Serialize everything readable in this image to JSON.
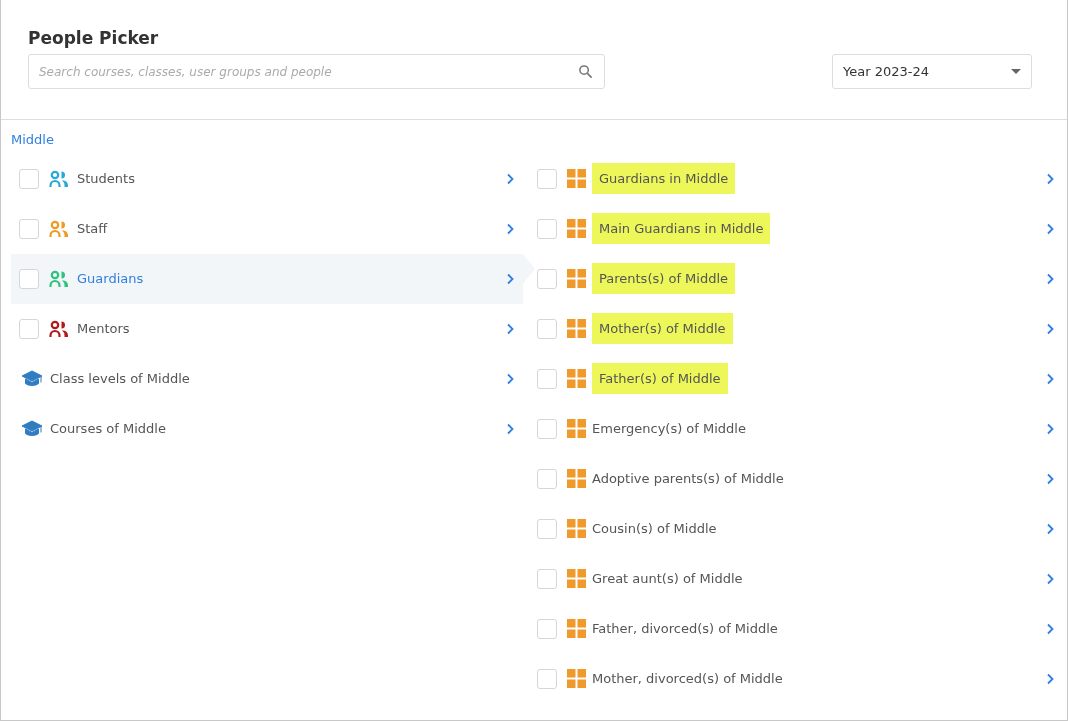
{
  "title": "People Picker",
  "search": {
    "placeholder": "Search courses, classes, user groups and people"
  },
  "year_select": {
    "value": "Year 2023-24"
  },
  "breadcrumb": "Middle",
  "categories": [
    {
      "kind": "group",
      "label": "Students",
      "color": "#29a8d8",
      "checked": false,
      "selected": false
    },
    {
      "kind": "group",
      "label": "Staff",
      "color": "#ef9a1f",
      "checked": false,
      "selected": false
    },
    {
      "kind": "group",
      "label": "Guardians",
      "color": "#2ec27e",
      "checked": false,
      "selected": true
    },
    {
      "kind": "group",
      "label": "Mentors",
      "color": "#b3191c",
      "checked": false,
      "selected": false
    },
    {
      "kind": "cap",
      "label": "Class levels of Middle",
      "selected": false
    },
    {
      "kind": "cap",
      "label": "Courses of Middle",
      "selected": false
    }
  ],
  "user_groups": [
    {
      "label": "Guardians in Middle",
      "checked": false,
      "highlighted": true
    },
    {
      "label": "Main Guardians in Middle",
      "checked": false,
      "highlighted": true
    },
    {
      "label": "Parents(s) of Middle",
      "checked": false,
      "highlighted": true
    },
    {
      "label": "Mother(s) of Middle",
      "checked": false,
      "highlighted": true
    },
    {
      "label": "Father(s) of Middle",
      "checked": false,
      "highlighted": true
    },
    {
      "label": "Emergency(s) of Middle",
      "checked": false,
      "highlighted": false
    },
    {
      "label": "Adoptive parents(s) of Middle",
      "checked": false,
      "highlighted": false
    },
    {
      "label": "Cousin(s) of Middle",
      "checked": false,
      "highlighted": false
    },
    {
      "label": "Great aunt(s) of Middle",
      "checked": false,
      "highlighted": false
    },
    {
      "label": "Father, divorced(s) of Middle",
      "checked": false,
      "highlighted": false
    },
    {
      "label": "Mother, divorced(s) of Middle",
      "checked": false,
      "highlighted": false
    }
  ]
}
